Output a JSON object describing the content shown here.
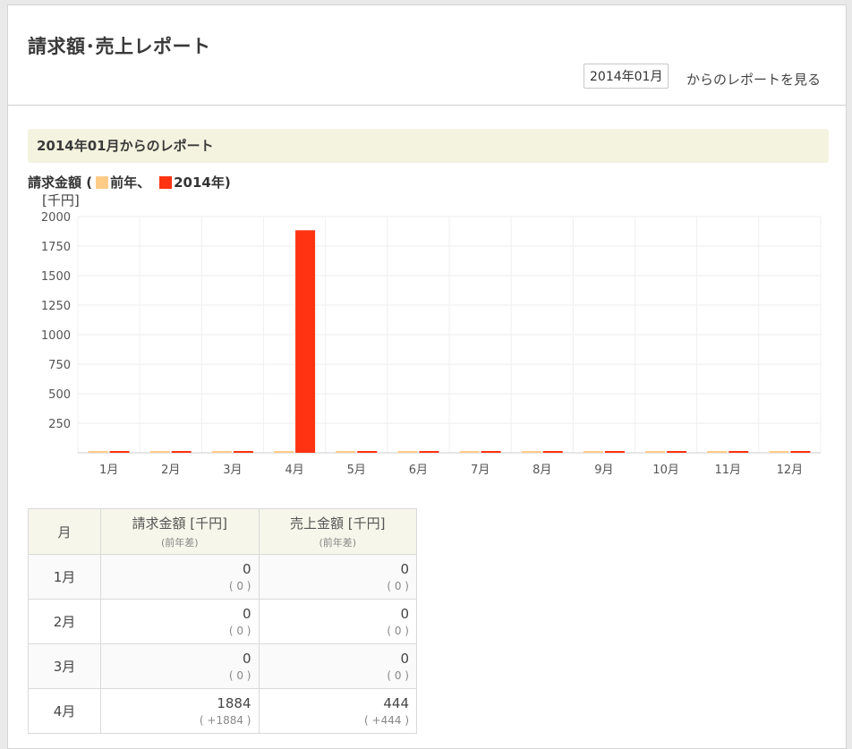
{
  "header": {
    "title": "請求額･売上レポート",
    "month_value": "2014年01月",
    "view_link": "からのレポートを見る"
  },
  "section": {
    "banner": "2014年01月からのレポート"
  },
  "chart_legend": {
    "prefix": "請求金額 (",
    "prev_label": "前年、",
    "curr_label": "2014年)",
    "unit": "[千円]",
    "prev_color": "#ffcc88",
    "curr_color": "#ff3311"
  },
  "chart_data": {
    "type": "bar",
    "title": "請求金額",
    "ylabel": "[千円]",
    "xlabel": "",
    "categories": [
      "1月",
      "2月",
      "3月",
      "4月",
      "5月",
      "6月",
      "7月",
      "8月",
      "9月",
      "10月",
      "11月",
      "12月"
    ],
    "ylim": [
      0,
      2000
    ],
    "yticks": [
      250,
      500,
      750,
      1000,
      1250,
      1500,
      1750,
      2000
    ],
    "grid": true,
    "series": [
      {
        "name": "前年",
        "color": "#ffcc88",
        "values": [
          0,
          0,
          0,
          0,
          0,
          0,
          0,
          0,
          0,
          0,
          0,
          0
        ]
      },
      {
        "name": "2014年",
        "color": "#ff3311",
        "values": [
          0,
          0,
          0,
          1884,
          0,
          0,
          0,
          0,
          0,
          0,
          0,
          0
        ]
      }
    ]
  },
  "table": {
    "headers": {
      "month": "月",
      "billing": "請求金額 [千円]",
      "billing_sub": "(前年差)",
      "sales": "売上金額 [千円]",
      "sales_sub": "(前年差)"
    },
    "rows": [
      {
        "month": "1月",
        "billing": "0",
        "billing_diff": "( 0 )",
        "sales": "0",
        "sales_diff": "( 0 )"
      },
      {
        "month": "2月",
        "billing": "0",
        "billing_diff": "( 0 )",
        "sales": "0",
        "sales_diff": "( 0 )"
      },
      {
        "month": "3月",
        "billing": "0",
        "billing_diff": "( 0 )",
        "sales": "0",
        "sales_diff": "( 0 )"
      },
      {
        "month": "4月",
        "billing": "1884",
        "billing_diff": "( +1884 )",
        "sales": "444",
        "sales_diff": "( +444 )"
      }
    ]
  }
}
